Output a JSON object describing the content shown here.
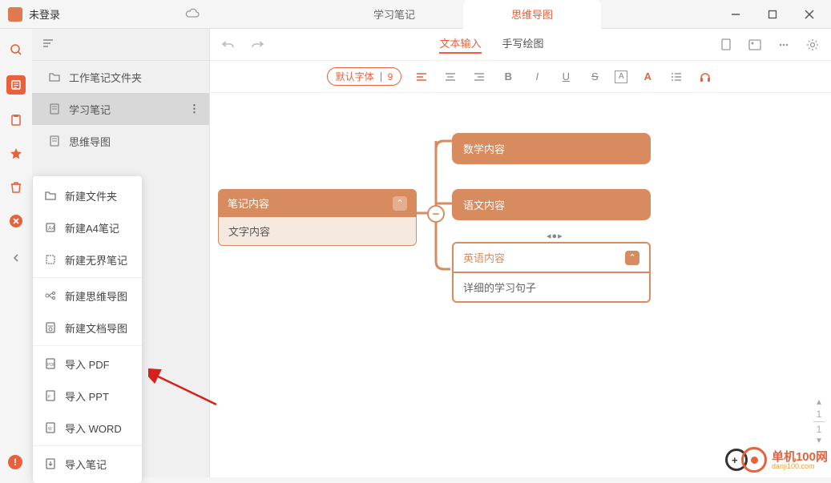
{
  "titlebar": {
    "login_status": "未登录"
  },
  "tabs": {
    "study_notes": "学习笔记",
    "mindmap": "思维导图"
  },
  "sidebar": {
    "items": [
      {
        "label": "工作笔记文件夹"
      },
      {
        "label": "学习笔记"
      },
      {
        "label": "思维导图"
      }
    ]
  },
  "toolbar": {
    "mode_text": "文本输入",
    "mode_draw": "手写绘图",
    "font_label": "默认字体",
    "font_size": "9"
  },
  "mindmap": {
    "root": {
      "title": "笔记内容",
      "body": "文字内容"
    },
    "children": [
      {
        "title": "数学内容"
      },
      {
        "title": "语文内容"
      },
      {
        "title": "英语内容",
        "body": "详细的学习句子"
      }
    ]
  },
  "context_menu": {
    "new_folder": "新建文件夹",
    "new_a4": "新建A4笔记",
    "new_unbounded": "新建无界笔记",
    "new_mindmap": "新建思维导图",
    "new_docmap": "新建文档导图",
    "import_pdf": "导入 PDF",
    "import_ppt": "导入 PPT",
    "import_word": "导入 WORD",
    "import_note": "导入笔记"
  },
  "pager": {
    "current": "1",
    "total": "1"
  },
  "watermark": {
    "cn": "单机100网",
    "en": "danji100.com"
  }
}
